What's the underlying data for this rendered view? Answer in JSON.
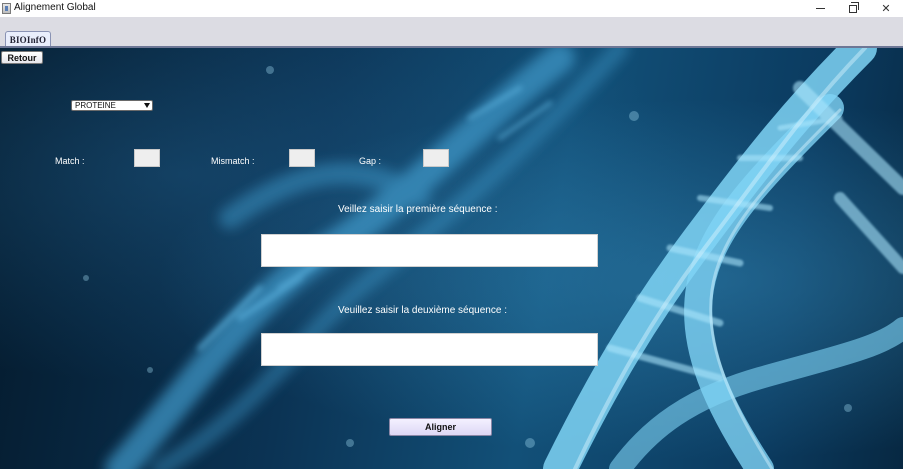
{
  "window": {
    "title": "Alignement Global",
    "close_glyph": "✕"
  },
  "tabs": [
    {
      "label": "BIOInfO",
      "active": true
    }
  ],
  "panel": {
    "back_button_label": "Retour",
    "sequence_type": {
      "selected": "PROTEINE"
    },
    "scoring": {
      "match_label": "Match :",
      "mismatch_label": "Mismatch :",
      "gap_label": "Gap :",
      "match_value": "",
      "mismatch_value": "",
      "gap_value": ""
    },
    "sequence1_prompt": "Veillez saisir la première séquence :",
    "sequence1_value": "",
    "sequence2_prompt": "Veuillez saisir la deuxième séquence :",
    "sequence2_value": "",
    "align_button_label": "Aligner"
  },
  "icons": {
    "app": "java-app-icon",
    "minimize": "minimize-icon",
    "restore": "restore-icon",
    "close": "close-icon",
    "dropdown": "chevron-down-icon"
  },
  "colors": {
    "background_dark": "#041a2c",
    "background_mid": "#125078",
    "dna_highlight": "#7fd3f5",
    "tab_strip": "#dcdce3",
    "label_text": "#ffffff"
  }
}
